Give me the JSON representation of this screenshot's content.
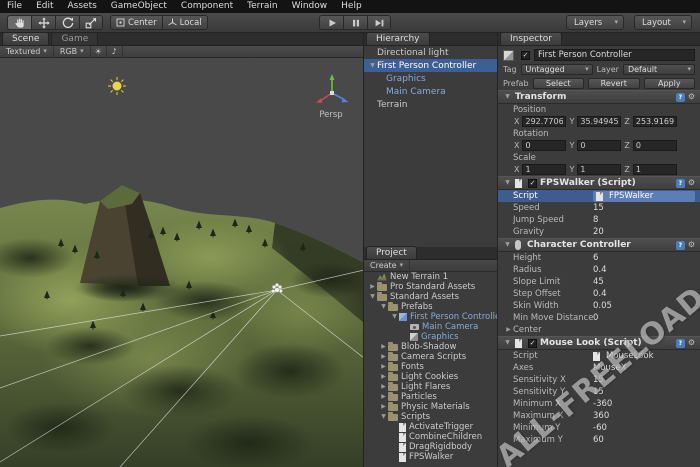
{
  "colors": {
    "selection_blue": "#3e5f96",
    "prefab_text_blue": "#86aadc",
    "script_row_highlight": "#3d5c90"
  },
  "icons": {
    "caret": "▾",
    "gear": "⚙",
    "check": "✓",
    "fold_open": "▼",
    "fold_closed": "▶",
    "help": "?",
    "lighting": "☀",
    "audio": "♪"
  },
  "menu": {
    "items": [
      "File",
      "Edit",
      "Assets",
      "GameObject",
      "Component",
      "Terrain",
      "Window",
      "Help"
    ]
  },
  "toolbar": {
    "center": "Center",
    "local": "Local",
    "layers": "Layers",
    "layout": "Layout"
  },
  "scene": {
    "tab_scene": "Scene",
    "tab_game": "Game",
    "draw_mode": "Textured",
    "color_mode": "RGB",
    "persp": "Persp"
  },
  "hierarchy": {
    "title": "Hierarchy",
    "items": [
      "Directional light",
      "First Person Controller",
      "Graphics",
      "Main Camera",
      "Terrain"
    ]
  },
  "project": {
    "title": "Project",
    "create": "Create",
    "items": [
      "New Terrain 1",
      "Pro Standard Assets",
      "Standard Assets",
      "Prefabs",
      "First Person Controller",
      "Main Camera",
      "Graphics",
      "Blob-Shadow",
      "Camera Scripts",
      "Fonts",
      "Light Cookies",
      "Light Flares",
      "Particles",
      "Physic Materials",
      "Scripts",
      "ActivateTrigger",
      "CombineChildren",
      "DragRigidbody",
      "FPSWalker"
    ]
  },
  "inspector": {
    "title": "Inspector",
    "name": "First Person Controller",
    "tag_label": "Tag",
    "tag_value": "Untagged",
    "layer_label": "Layer",
    "layer_value": "Default",
    "prefab_label": "Prefab",
    "prefab_buttons": {
      "select": "Select",
      "revert": "Revert",
      "apply": "Apply"
    },
    "axis": {
      "x": "X",
      "y": "Y",
      "z": "Z"
    },
    "transform": {
      "title": "Transform",
      "position_label": "Position",
      "rotation_label": "Rotation",
      "scale_label": "Scale",
      "position": {
        "x": "292.7706",
        "y": "35.94945",
        "z": "253.9169"
      },
      "rotation": {
        "x": "0",
        "y": "0",
        "z": "0"
      },
      "scale": {
        "x": "1",
        "y": "1",
        "z": "1"
      }
    },
    "fpswalker": {
      "title": "FPSWalker (Script)",
      "script_label": "Script",
      "script_value": "FPSWalker",
      "rows": [
        {
          "label": "Speed",
          "value": "15"
        },
        {
          "label": "Jump Speed",
          "value": "8"
        },
        {
          "label": "Gravity",
          "value": "20"
        }
      ]
    },
    "character": {
      "title": "Character Controller",
      "rows": [
        {
          "label": "Height",
          "value": "6"
        },
        {
          "label": "Radius",
          "value": "0.4"
        },
        {
          "label": "Slope Limit",
          "value": "45"
        },
        {
          "label": "Step Offset",
          "value": "0.4"
        },
        {
          "label": "Skin Width",
          "value": "0.05"
        },
        {
          "label": "Min Move Distance",
          "value": "0"
        }
      ],
      "center_label": "Center"
    },
    "mouselook": {
      "title": "Mouse Look (Script)",
      "script_label": "Script",
      "script_value": "MouseLook",
      "rows": [
        {
          "label": "Axes",
          "value": "MouseX"
        },
        {
          "label": "Sensitivity X",
          "value": "15"
        },
        {
          "label": "Sensitivity Y",
          "value": "15"
        },
        {
          "label": "Minimum X",
          "value": "-360"
        },
        {
          "label": "Maximum X",
          "value": "360"
        },
        {
          "label": "Minimum Y",
          "value": "-60"
        },
        {
          "label": "Maximum Y",
          "value": "60"
        }
      ]
    }
  },
  "watermark": "ALL-FREELOAD.NET"
}
